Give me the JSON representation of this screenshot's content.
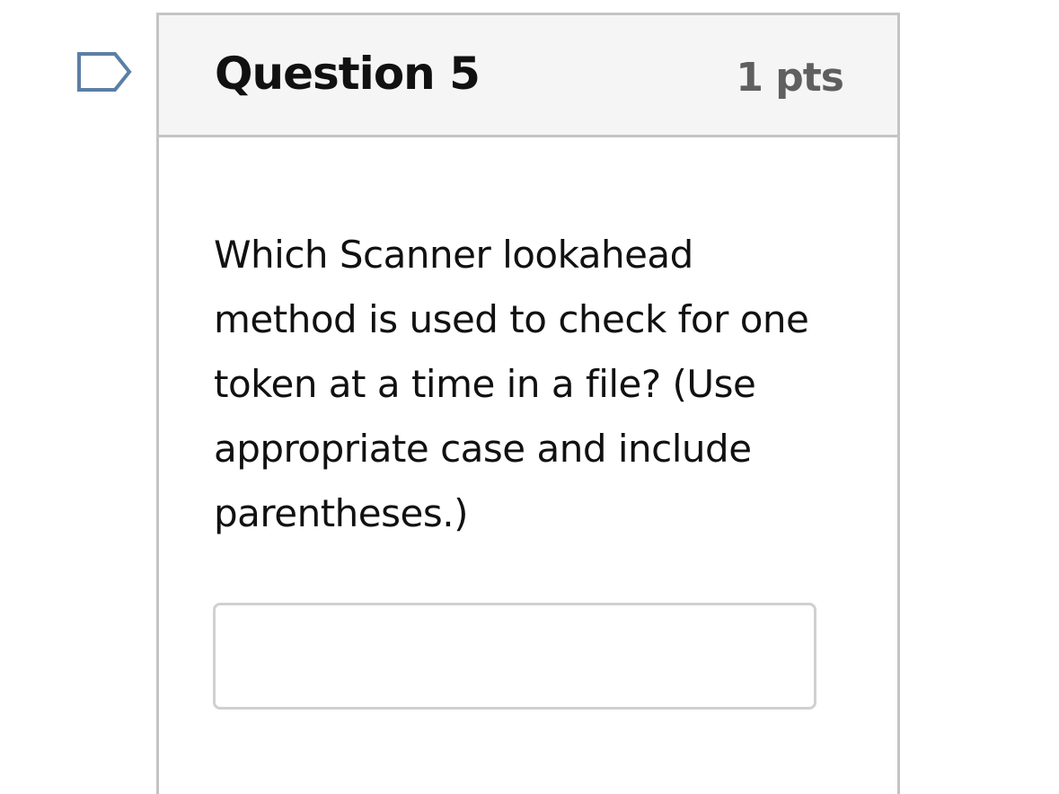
{
  "question": {
    "title": "Question 5",
    "points": "1 pts",
    "text": "Which Scanner lookahead method is used to check for one token at a time in a file? (Use appropriate case and include parentheses.)",
    "answer_value": "",
    "flag_icon": "flag-question-icon"
  },
  "colors": {
    "header_bg": "#f5f5f5",
    "border": "#c4c4c4",
    "points_text": "#5f5f5f",
    "flag_stroke": "#5b7fa6"
  }
}
